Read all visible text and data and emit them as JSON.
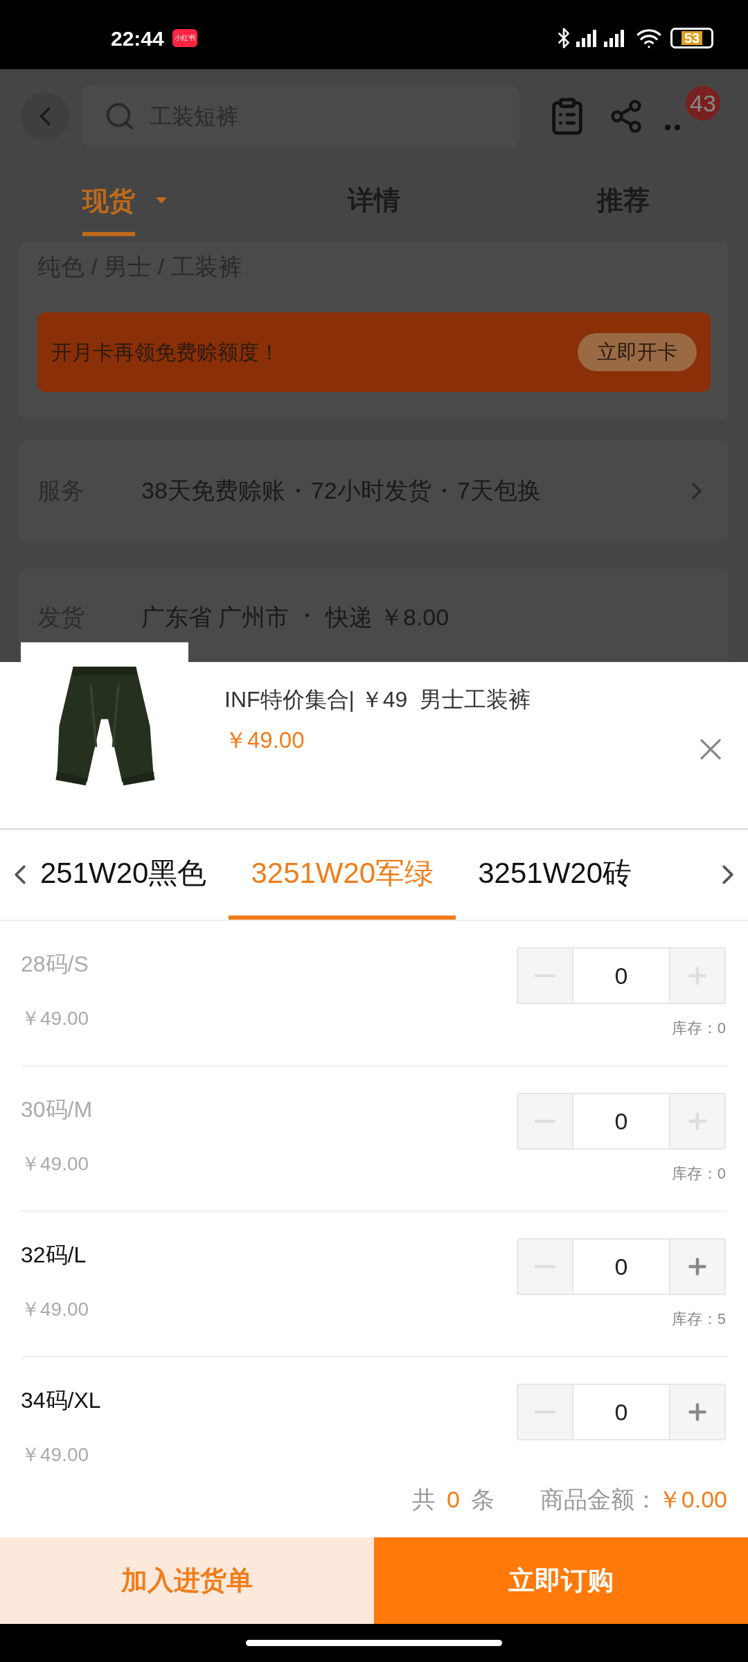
{
  "status_bar": {
    "time": "22:44",
    "app_badge": "小红书",
    "battery": "53"
  },
  "header": {
    "search": {
      "placeholder": "工装短裤"
    },
    "badge": "43"
  },
  "tabs": [
    {
      "label": "现货",
      "selected": true,
      "dropdown": true
    },
    {
      "label": "详情",
      "selected": false,
      "dropdown": false
    },
    {
      "label": "推荐",
      "selected": false,
      "dropdown": false
    }
  ],
  "breadcrumb": "纯色 / 男士 / 工装裤",
  "promo": {
    "text": "开月卡再领免费赊额度！",
    "button": "立即开卡"
  },
  "service": {
    "label": "服务",
    "items": [
      "38天免费赊账",
      "72小时发货",
      "7天包换"
    ]
  },
  "shipping": {
    "label": "发货",
    "items": [
      "广东省 广州市",
      "快递 ￥8.00"
    ]
  },
  "sheet": {
    "title": "INF特价集合| ￥49  男士工装裤",
    "price": "￥49.00",
    "variants": [
      {
        "label": "251W20黑色",
        "selected": false
      },
      {
        "label": "3251W20军绿",
        "selected": true
      },
      {
        "label": "3251W20砖",
        "selected": false
      }
    ],
    "sizes": [
      {
        "label": "28码/S",
        "price": "￥49.00",
        "quantity": "0",
        "in_stock": false,
        "stock": "库存：0"
      },
      {
        "label": "30码/M",
        "price": "￥49.00",
        "quantity": "0",
        "in_stock": false,
        "stock": "库存：0"
      },
      {
        "label": "32码/L",
        "price": "￥49.00",
        "quantity": "0",
        "in_stock": true,
        "stock": "库存：5"
      },
      {
        "label": "34码/XL",
        "price": "￥49.00",
        "quantity": "0",
        "in_stock": true
      }
    ],
    "summary": {
      "prefix": "共",
      "count": "0",
      "suffix": "条",
      "amount_label": "商品金额：",
      "amount": "￥0.00"
    },
    "buttons": {
      "cart": "加入进货单",
      "order": "立即订购"
    }
  }
}
